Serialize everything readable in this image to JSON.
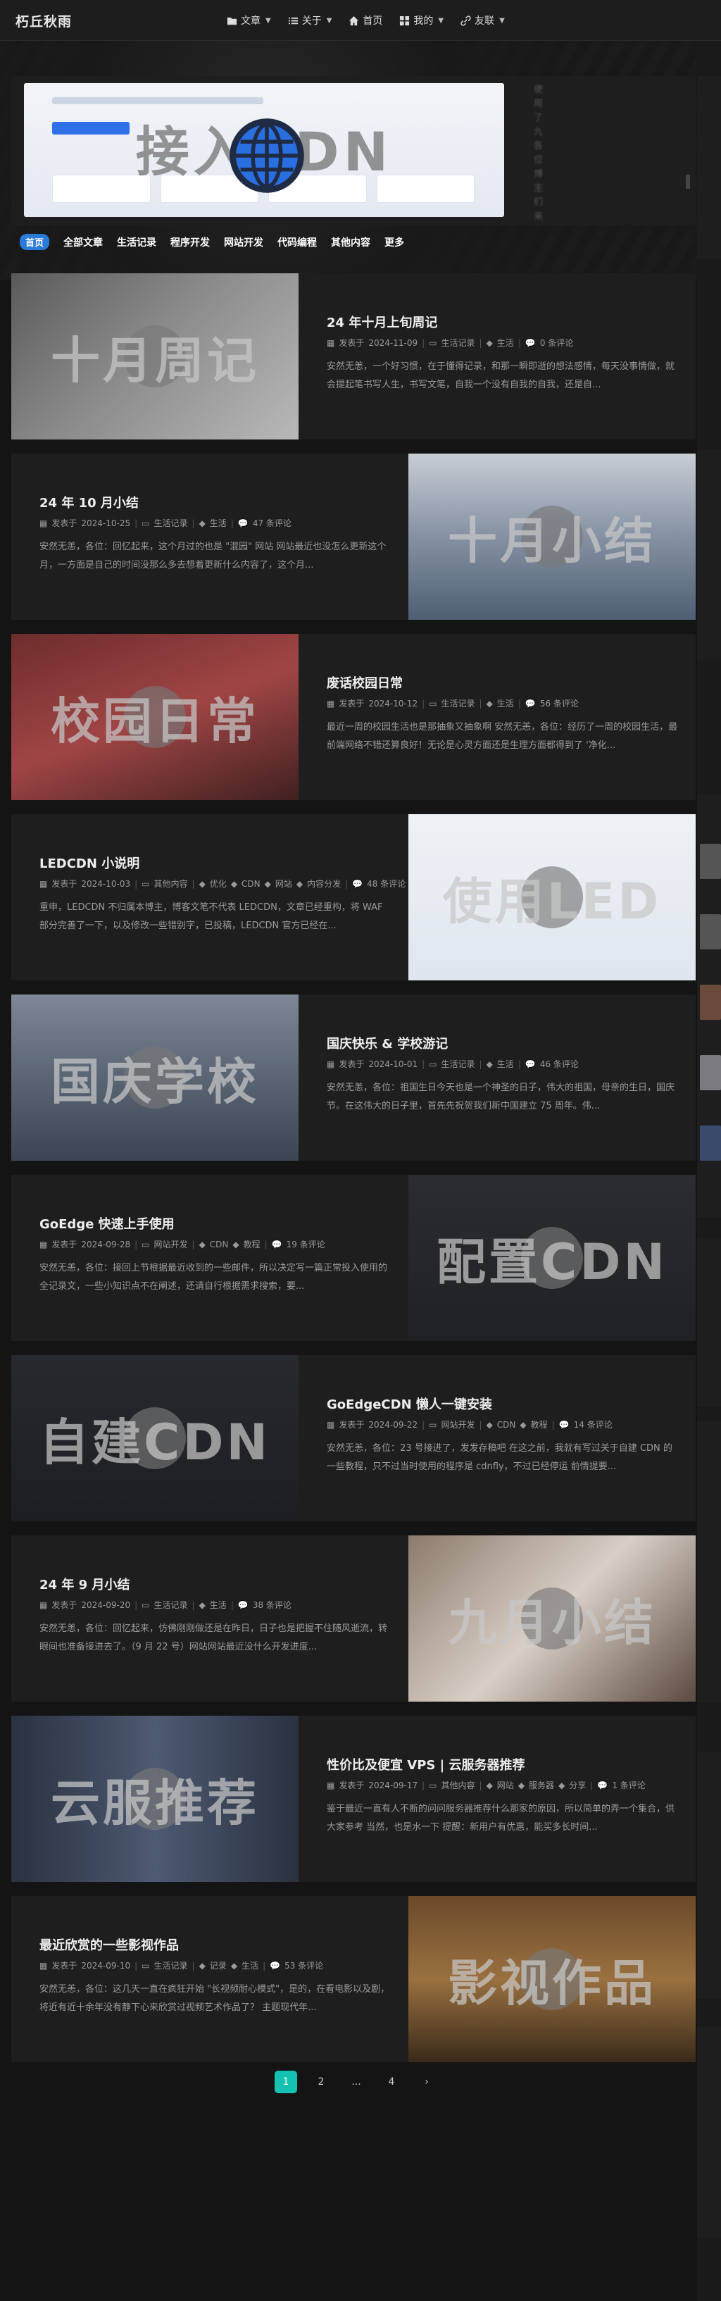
{
  "site": {
    "logo": "朽丘秋雨"
  },
  "nav": {
    "items": [
      {
        "label": "文章",
        "icon": "folder-icon",
        "dropdown": true
      },
      {
        "label": "关于",
        "icon": "list-icon",
        "dropdown": true
      },
      {
        "label": "首页",
        "icon": "home-icon",
        "dropdown": false
      },
      {
        "label": "我的",
        "icon": "grid-icon",
        "dropdown": true
      },
      {
        "label": "友联",
        "icon": "link-icon",
        "dropdown": true
      }
    ]
  },
  "banner": {
    "text": "接入CDN",
    "side_text": [
      "使",
      "用",
      "了",
      "九",
      "各",
      "位",
      "博",
      "主",
      "们",
      "来",
      "商",
      "接",
      "供",
      "CD",
      "N",
      "加",
      "速",
      "的",
      "服",
      "务"
    ]
  },
  "categories": {
    "active": "首页",
    "items": [
      "全部文章",
      "生活记录",
      "程序开发",
      "网站开发",
      "代码编程",
      "其他内容",
      "更多"
    ]
  },
  "posts": [
    {
      "title": "24 年十月上旬周记",
      "cover": "十月周记",
      "date": "2024-11-09",
      "category": "生活记录",
      "tags": [
        "生活"
      ],
      "comments": "0 条评论",
      "excerpt": "安然无恙，一个好习惯，在于懂得记录，和那一瞬即逝的想法感情，每天没事情做，就会提起笔书写人生，书写文笔，自我一个没有自我的自我，还是自..."
    },
    {
      "title": "24 年 10 月小结",
      "cover": "十月小结",
      "date": "2024-10-25",
      "category": "生活记录",
      "tags": [
        "生活"
      ],
      "comments": "47 条评论",
      "excerpt": "安然无恙，各位：回忆起来，这个月过的也是 \"混园\" 网站 网站最近也没怎么更新这个月，一方面是自己的时间没那么多去想着更新什么内容了，这个月..."
    },
    {
      "title": "废话校园日常",
      "cover": "校园日常",
      "date": "2024-10-12",
      "category": "生活记录",
      "tags": [
        "生活"
      ],
      "comments": "56 条评论",
      "excerpt": "最近一周的校园生活也是那抽象又抽象啊 安然无恙，各位：经历了一周的校园生活，最前端网络不错还算良好！无论是心灵方面还是生理方面都得到了 '净化..."
    },
    {
      "title": "LEDCDN 小说明",
      "cover": "使用LED",
      "date": "2024-10-03",
      "category": "其他内容",
      "tags": [
        "优化",
        "CDN",
        "网站",
        "内容分发"
      ],
      "comments": "48 条评论",
      "excerpt": "重申，LEDCDN 不归属本博主，博客文笔不代表 LEDCDN，文章已经重构，将 WAF 部分完善了一下，以及修改一些错别字，已投稿，LEDCDN 官方已经在..."
    },
    {
      "title": "国庆快乐 & 学校游记",
      "cover": "国庆学校",
      "date": "2024-10-01",
      "category": "生活记录",
      "tags": [
        "生活"
      ],
      "comments": "46 条评论",
      "excerpt": "安然无恙，各位：祖国生日今天也是一个神圣的日子，伟大的祖国，母亲的生日，国庆节。在这伟大的日子里，首先先祝贺我们新中国建立 75 周年。伟..."
    },
    {
      "title": "GoEdge 快速上手使用",
      "cover": "配置CDN",
      "date": "2024-09-28",
      "category": "网站开发",
      "tags": [
        "CDN",
        "教程"
      ],
      "comments": "19 条评论",
      "excerpt": "安然无恙，各位：接回上节根据最近收到的一些邮件，所以决定写一篇正常投入使用的全记录文，一些小知识点不在阐述，还请自行根据需求搜索，要..."
    },
    {
      "title": "GoEdgeCDN 懒人一键安装",
      "cover": "自建CDN",
      "date": "2024-09-22",
      "category": "网站开发",
      "tags": [
        "CDN",
        "教程"
      ],
      "comments": "14 条评论",
      "excerpt": "安然无恙，各位：23 号接进了，发发存稿吧 在这之前，我就有写过关于自建 CDN 的一些教程，只不过当时使用的程序是 cdnfly，不过已经停运 前情提要..."
    },
    {
      "title": "24 年 9 月小结",
      "cover": "九月小结",
      "date": "2024-09-20",
      "category": "生活记录",
      "tags": [
        "生活"
      ],
      "comments": "38 条评论",
      "excerpt": "安然无恙，各位：回忆起来，仿佛刚刚做还是在昨日，日子也是把握不住随风逝流，转眼间也准备接进去了。（9 月 22 号）网站网站最近没什么开发进度..."
    },
    {
      "title": "性价比及便宜 VPS | 云服务器推荐",
      "cover": "云服推荐",
      "date": "2024-09-17",
      "category": "其他内容",
      "tags": [
        "网站",
        "服务器",
        "分享"
      ],
      "comments": "1 条评论",
      "excerpt": "鉴于最近一直有人不断的问问服务器推荐什么那家的原因，所以简单的弄一个集合，供大家参考 当然，也是水一下 提醒：新用户有优惠，能买多长时间..."
    },
    {
      "title": "最近欣赏的一些影视作品",
      "cover": "影视作品",
      "date": "2024-09-10",
      "category": "生活记录",
      "tags": [
        "记录",
        "生活"
      ],
      "comments": "53 条评论",
      "excerpt": "安然无恙，各位：这几天一直在疯狂开始 \"长视频耐心模式\"，是的，在看电影以及剧，将近有近十余年没有静下心来欣赏过视频艺术作品了？ 主题现代年..."
    }
  ],
  "meta_labels": {
    "published": "发表于"
  },
  "pagination": {
    "pages": [
      "1",
      "2",
      "...",
      "4"
    ],
    "current": "1",
    "next": "›"
  },
  "colors": {
    "accent": "#15c1b1",
    "tab_active": "#2a7ad9",
    "bg": "#141414",
    "card": "#1e1e1e"
  }
}
